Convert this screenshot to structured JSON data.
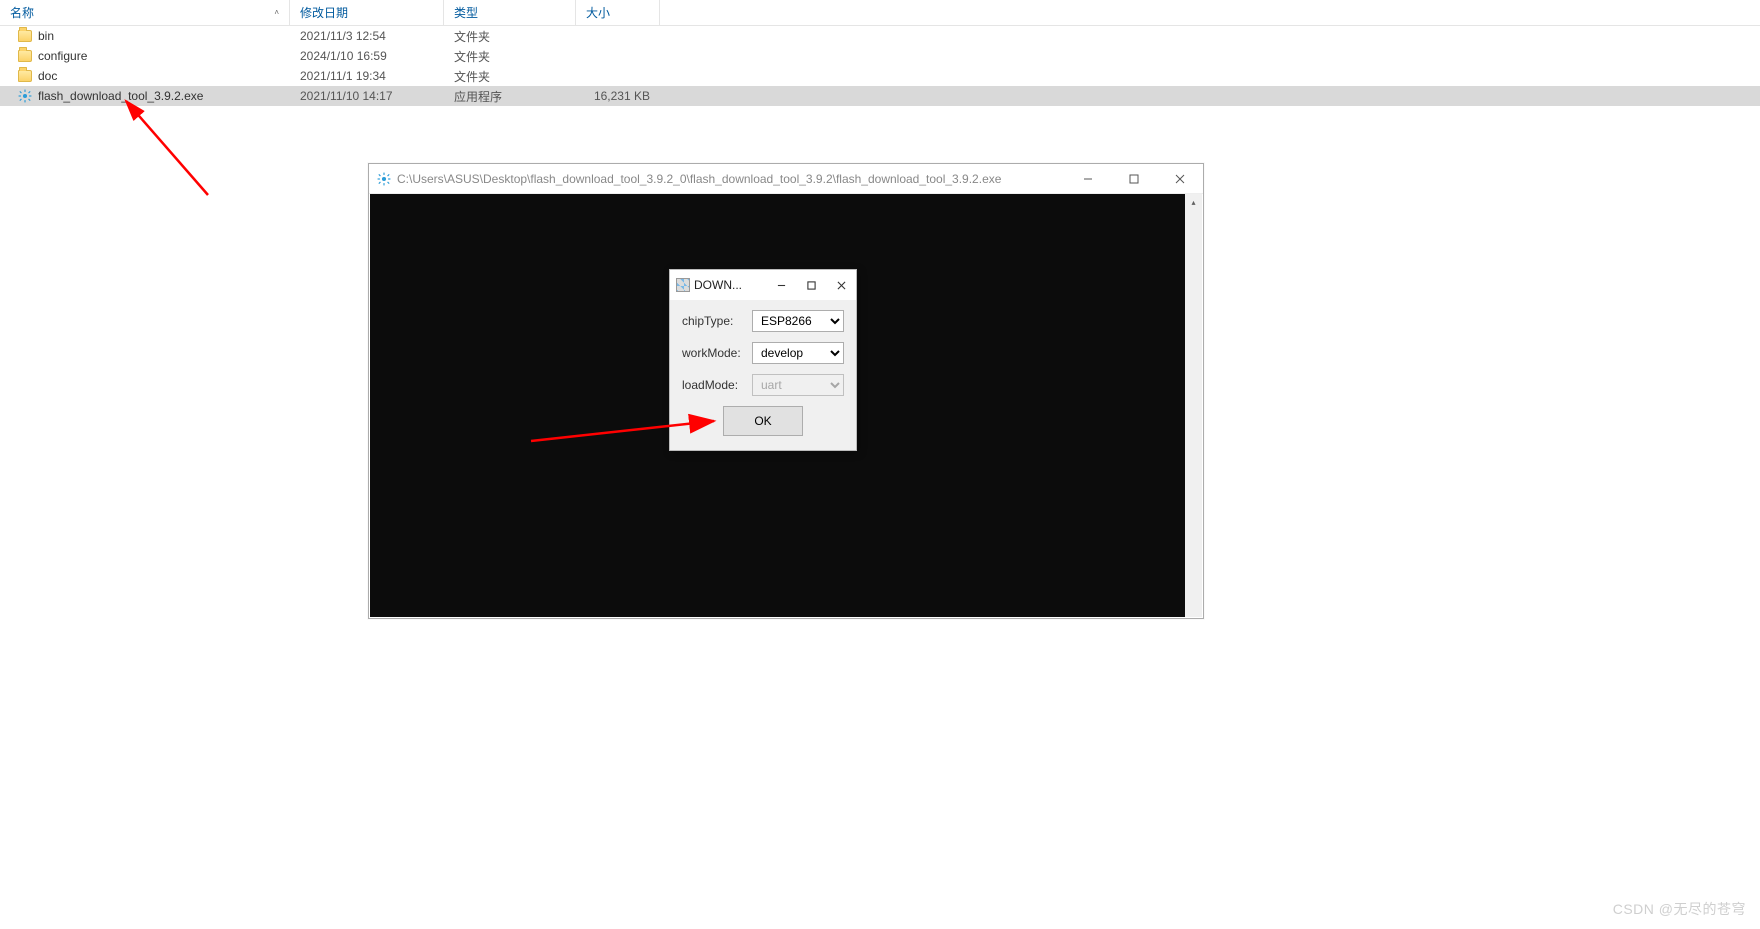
{
  "explorer": {
    "headers": {
      "name": "名称",
      "date": "修改日期",
      "type": "类型",
      "size": "大小"
    },
    "rows": [
      {
        "name": "bin",
        "date": "2021/11/3 12:54",
        "type": "文件夹",
        "size": "",
        "icon": "folder"
      },
      {
        "name": "configure",
        "date": "2024/1/10 16:59",
        "type": "文件夹",
        "size": "",
        "icon": "folder"
      },
      {
        "name": "doc",
        "date": "2021/11/1 19:34",
        "type": "文件夹",
        "size": "",
        "icon": "folder"
      },
      {
        "name": "flash_download_tool_3.9.2.exe",
        "date": "2021/11/10 14:17",
        "type": "应用程序",
        "size": "16,231 KB",
        "icon": "gear"
      }
    ]
  },
  "console": {
    "title": "C:\\Users\\ASUS\\Desktop\\flash_download_tool_3.9.2_0\\flash_download_tool_3.9.2\\flash_download_tool_3.9.2.exe"
  },
  "dialog": {
    "title": "DOWN...",
    "fields": {
      "chipType": {
        "label": "chipType:",
        "value": "ESP8266"
      },
      "workMode": {
        "label": "workMode:",
        "value": "develop"
      },
      "loadMode": {
        "label": "loadMode:",
        "value": "uart"
      }
    },
    "ok": "OK"
  },
  "watermark": "CSDN @无尽的苍穹"
}
